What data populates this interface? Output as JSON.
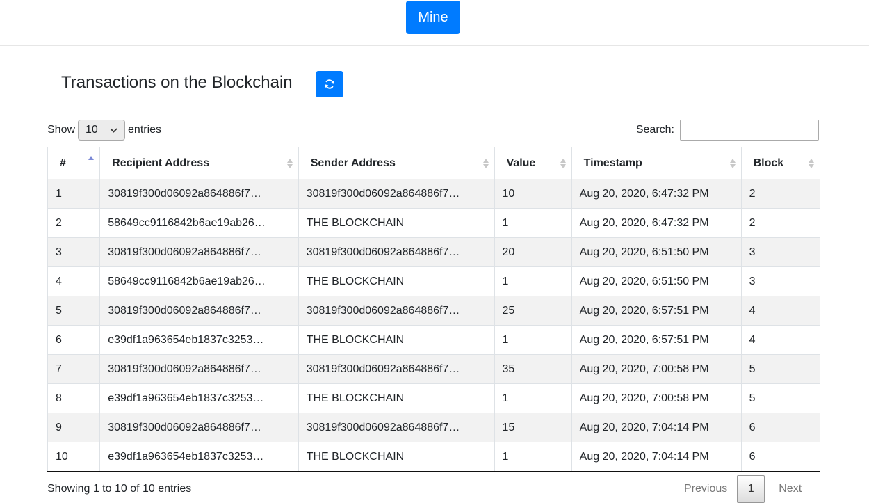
{
  "header": {
    "mine_label": "Mine"
  },
  "section": {
    "title": "Transactions on the Blockchain"
  },
  "controls": {
    "show_label": "Show",
    "length_value": "10",
    "entries_label": "entries",
    "search_label": "Search:",
    "search_value": ""
  },
  "table": {
    "columns": [
      "#",
      "Recipient Address",
      "Sender Address",
      "Value",
      "Timestamp",
      "Block"
    ],
    "sorted_column": "#",
    "rows": [
      [
        "1",
        "30819f300d06092a864886f7…",
        "30819f300d06092a864886f7…",
        "10",
        "Aug 20, 2020, 6:47:32 PM",
        "2"
      ],
      [
        "2",
        "58649cc9116842b6ae19ab26…",
        "THE BLOCKCHAIN",
        "1",
        "Aug 20, 2020, 6:47:32 PM",
        "2"
      ],
      [
        "3",
        "30819f300d06092a864886f7…",
        "30819f300d06092a864886f7…",
        "20",
        "Aug 20, 2020, 6:51:50 PM",
        "3"
      ],
      [
        "4",
        "58649cc9116842b6ae19ab26…",
        "THE BLOCKCHAIN",
        "1",
        "Aug 20, 2020, 6:51:50 PM",
        "3"
      ],
      [
        "5",
        "30819f300d06092a864886f7…",
        "30819f300d06092a864886f7…",
        "25",
        "Aug 20, 2020, 6:57:51 PM",
        "4"
      ],
      [
        "6",
        "e39df1a963654eb1837c3253…",
        "THE BLOCKCHAIN",
        "1",
        "Aug 20, 2020, 6:57:51 PM",
        "4"
      ],
      [
        "7",
        "30819f300d06092a864886f7…",
        "30819f300d06092a864886f7…",
        "35",
        "Aug 20, 2020, 7:00:58 PM",
        "5"
      ],
      [
        "8",
        "e39df1a963654eb1837c3253…",
        "THE BLOCKCHAIN",
        "1",
        "Aug 20, 2020, 7:00:58 PM",
        "5"
      ],
      [
        "9",
        "30819f300d06092a864886f7…",
        "30819f300d06092a864886f7…",
        "15",
        "Aug 20, 2020, 7:04:14 PM",
        "6"
      ],
      [
        "10",
        "e39df1a963654eb1837c3253…",
        "THE BLOCKCHAIN",
        "1",
        "Aug 20, 2020, 7:04:14 PM",
        "6"
      ]
    ]
  },
  "footer": {
    "info": "Showing 1 to 10 of 10 entries",
    "previous_label": "Previous",
    "current_page": "1",
    "next_label": "Next"
  },
  "icons": {
    "refresh": "refresh-icon",
    "dropdown": "chevron-down-icon",
    "sort": "sort-icon"
  },
  "colors": {
    "primary": "#007bff",
    "stripe": "#f2f2f2",
    "sort_active": "#7b89d6",
    "sort_inactive": "#c8c8c8"
  }
}
